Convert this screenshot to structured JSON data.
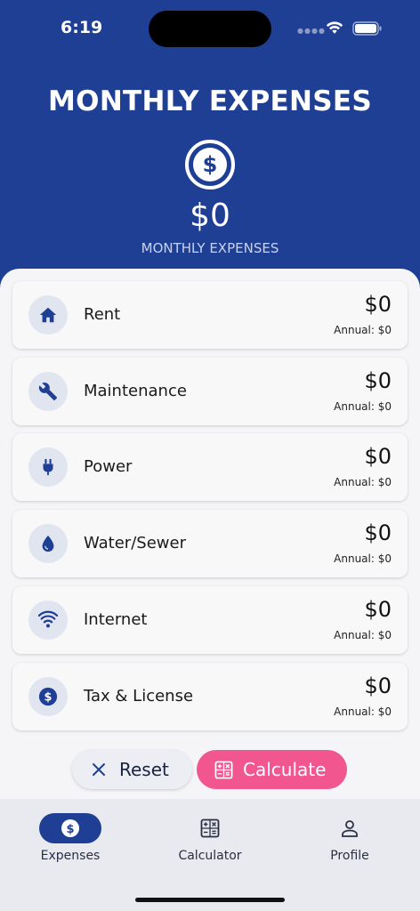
{
  "status_bar": {
    "time": "6:19"
  },
  "header": {
    "title": "MONTHLY EXPENSES",
    "total": "$0",
    "caption": "MONTHLY EXPENSES",
    "icon": "dollar-circle-icon"
  },
  "expenses": [
    {
      "label": "Rent",
      "amount": "$0",
      "annual": "Annual: $0",
      "icon": "home-icon"
    },
    {
      "label": "Maintenance",
      "amount": "$0",
      "annual": "Annual: $0",
      "icon": "wrench-icon"
    },
    {
      "label": "Power",
      "amount": "$0",
      "annual": "Annual: $0",
      "icon": "plug-icon"
    },
    {
      "label": "Water/Sewer",
      "amount": "$0",
      "annual": "Annual: $0",
      "icon": "water-drop-icon"
    },
    {
      "label": "Internet",
      "amount": "$0",
      "annual": "Annual: $0",
      "icon": "wifi-icon"
    },
    {
      "label": "Tax & License",
      "amount": "$0",
      "annual": "Annual: $0",
      "icon": "dollar-icon"
    }
  ],
  "actions": {
    "reset_label": "Reset",
    "calculate_label": "Calculate"
  },
  "tabs": [
    {
      "label": "Expenses",
      "icon": "dollar-circle-icon",
      "active": true
    },
    {
      "label": "Calculator",
      "icon": "calculator-icon",
      "active": false
    },
    {
      "label": "Profile",
      "icon": "person-icon",
      "active": false
    }
  ],
  "colors": {
    "primary": "#1f3f94",
    "accent_pink": "#f2568f",
    "icon_bg": "#e1e5f0",
    "background": "#f4f4f6"
  }
}
